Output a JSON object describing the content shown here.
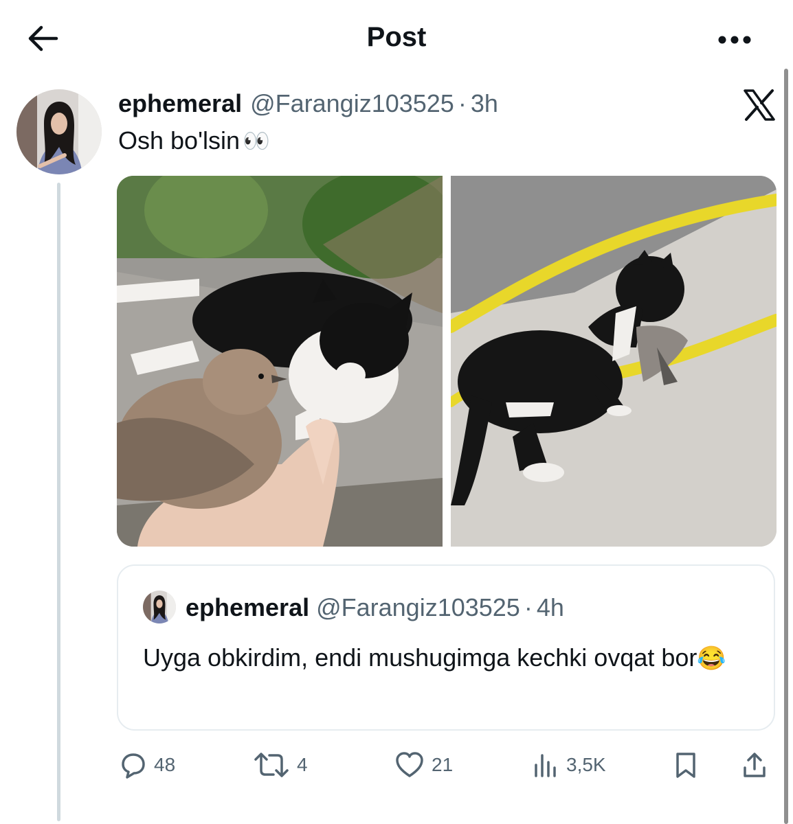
{
  "header": {
    "title": "Post"
  },
  "post": {
    "display_name": "ephemeral",
    "handle": "@Farangiz103525",
    "separator": "·",
    "time": "3h",
    "text": "Osh bo'lsin",
    "text_emoji": "👀",
    "media": [
      {
        "alt": "cat"
      },
      {
        "alt": "cat"
      }
    ]
  },
  "quote": {
    "display_name": "ephemeral",
    "handle": "@Farangiz103525",
    "separator": "·",
    "time": "4h",
    "text": "Uyga obkirdim, endi mushugimga kechki ovqat bor",
    "text_emoji": "😂"
  },
  "actions": {
    "replies": "48",
    "reposts": "4",
    "likes": "21",
    "views": "3,5K"
  },
  "colors": {
    "text_primary": "#0f1419",
    "text_secondary": "#536471",
    "border": "#e6ecf0",
    "thread_line": "#cfd9de"
  }
}
